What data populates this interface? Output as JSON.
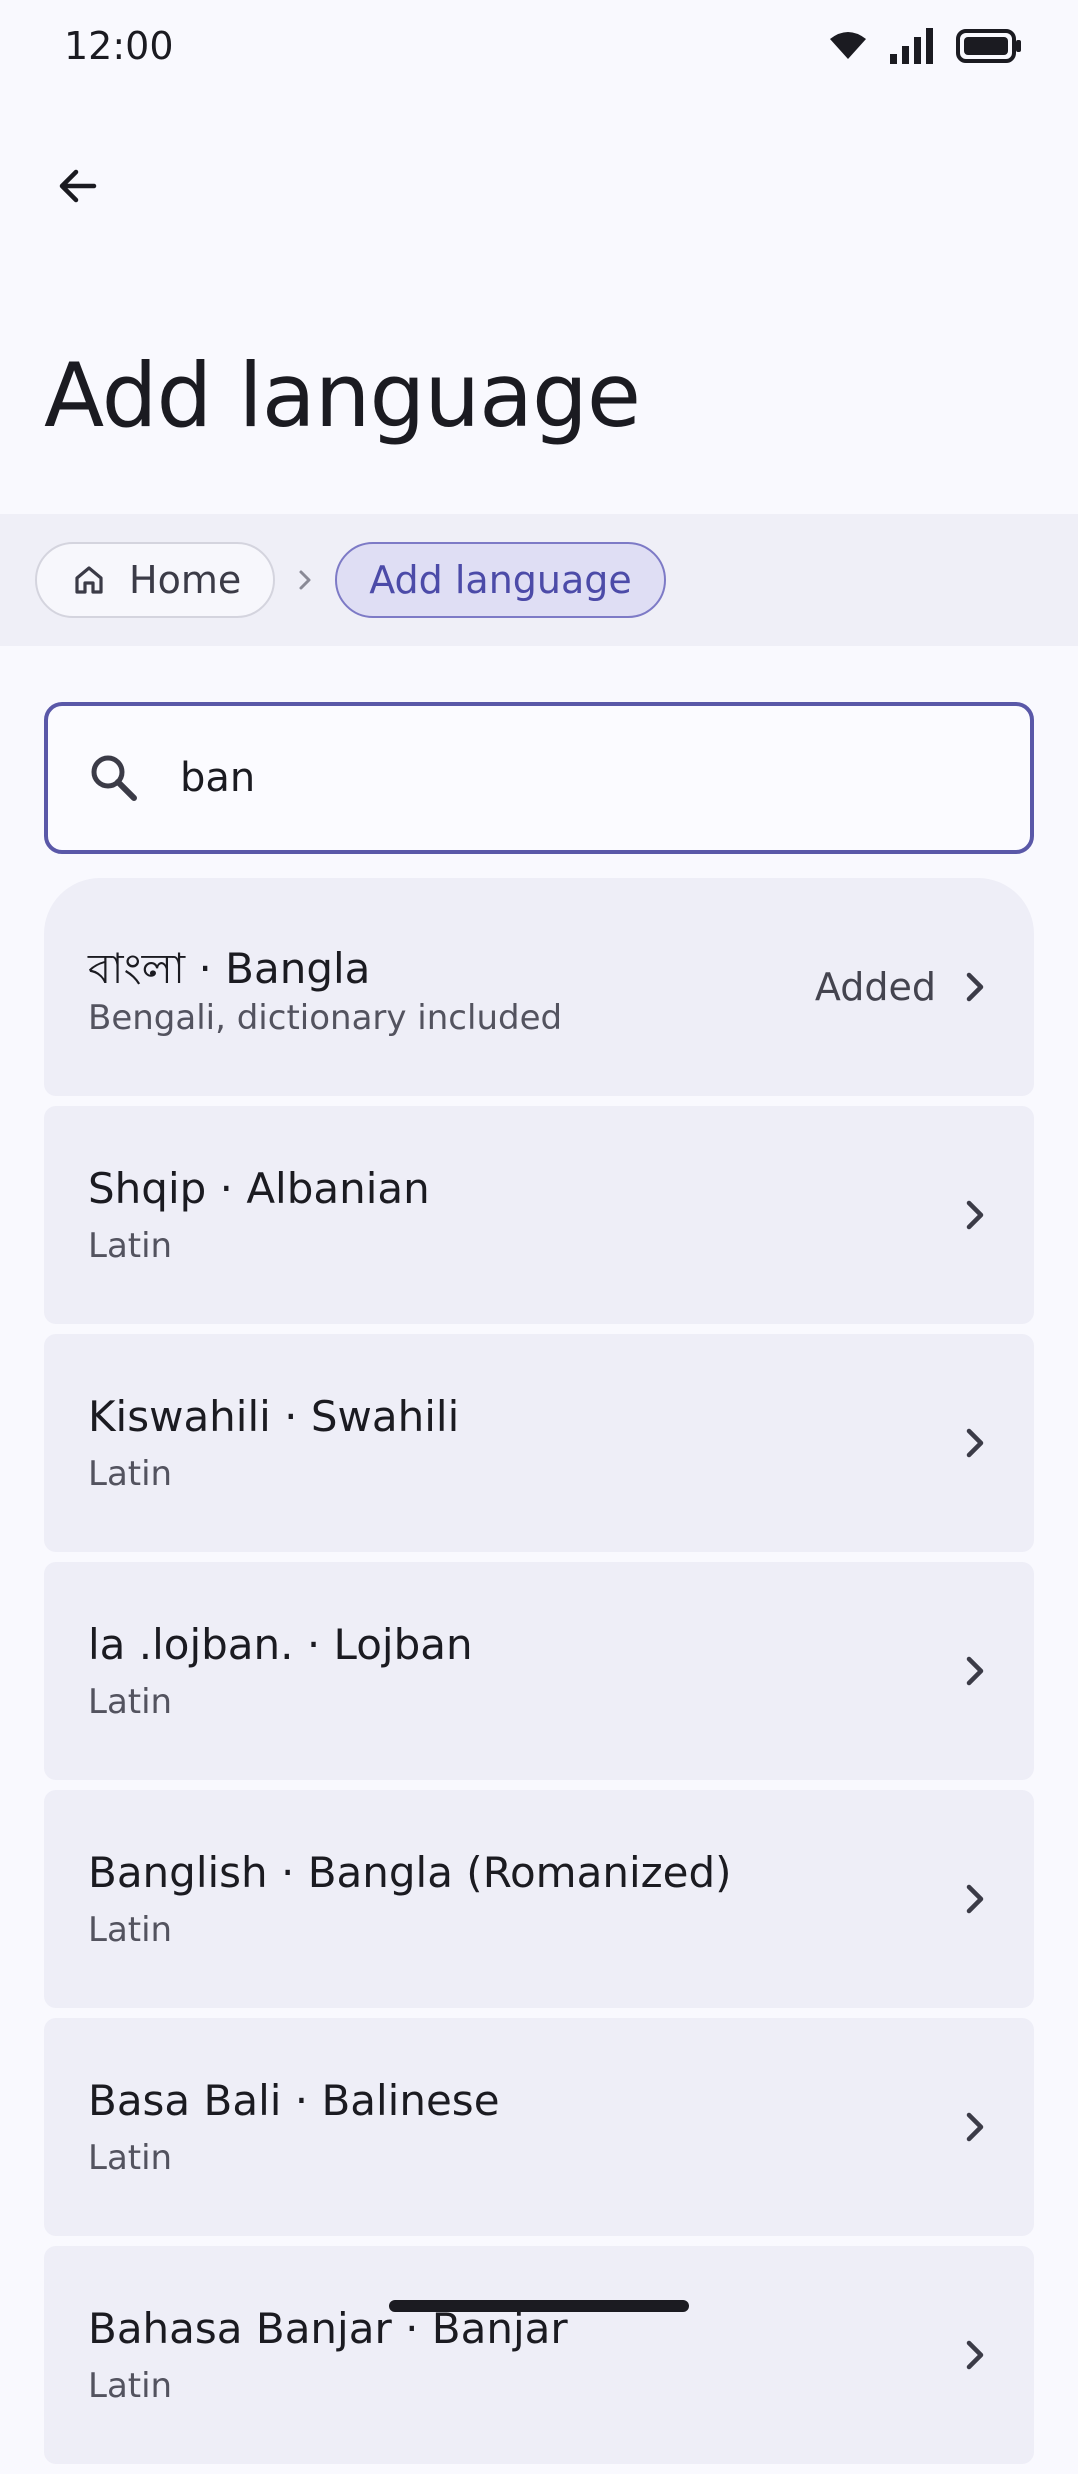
{
  "status_bar": {
    "time": "12:00",
    "icons": [
      "wifi-icon",
      "signal-icon",
      "battery-icon"
    ]
  },
  "top_bar": {
    "back_icon": "arrow-back-icon"
  },
  "page": {
    "title": "Add language"
  },
  "breadcrumb": {
    "items": [
      {
        "label": "Home",
        "icon": "home-icon"
      },
      {
        "label": "Add language",
        "current": true
      }
    ],
    "separator_icon": "chevron-right-icon"
  },
  "search": {
    "value": "ban",
    "icon": "search-icon"
  },
  "languages": [
    {
      "title": "বাংলা · Bangla",
      "subtitle": "Bengali, dictionary included",
      "status": "Added"
    },
    {
      "title": "Shqip · Albanian",
      "subtitle": "Latin",
      "status": ""
    },
    {
      "title": "Kiswahili · Swahili",
      "subtitle": "Latin",
      "status": ""
    },
    {
      "title": "la .lojban. · Lojban",
      "subtitle": "Latin",
      "status": ""
    },
    {
      "title": "Banglish · Bangla (Romanized)",
      "subtitle": "Latin",
      "status": ""
    },
    {
      "title": "Basa Bali · Balinese",
      "subtitle": "Latin",
      "status": ""
    },
    {
      "title": "Bahasa Banjar · Banjar",
      "subtitle": "Latin",
      "status": ""
    }
  ],
  "colors": {
    "background": "#F9F9FE",
    "accent": "#5A58A8",
    "list_item": "#EEEEF7",
    "breadcrumb_bar": "#EFEFF7"
  }
}
